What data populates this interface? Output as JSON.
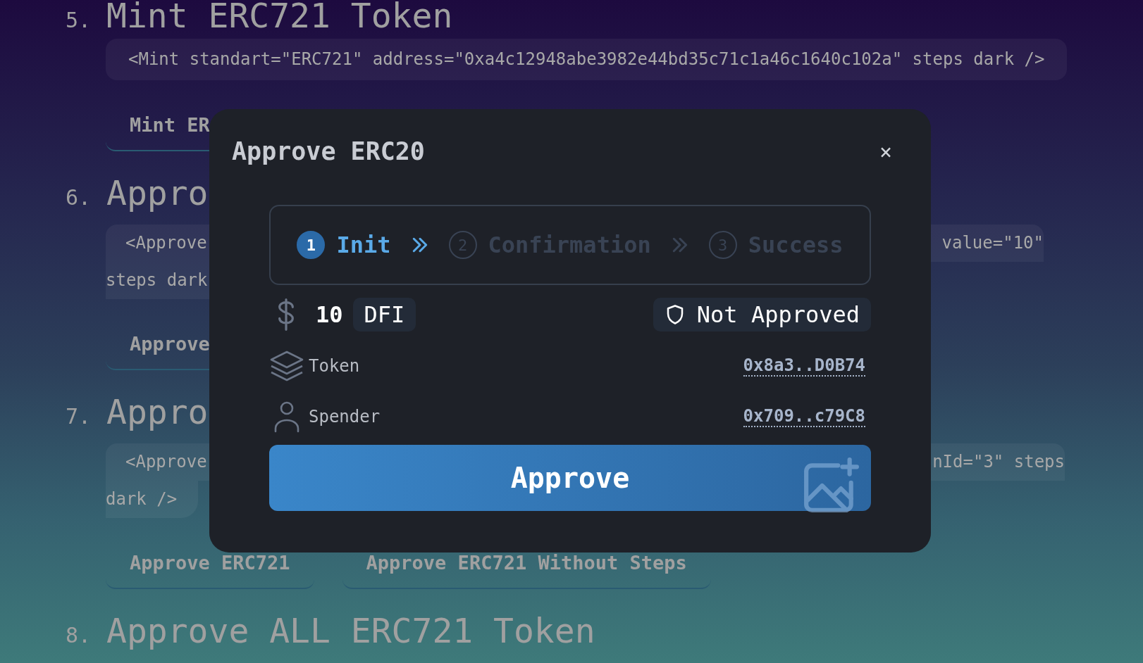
{
  "sections": [
    {
      "number": "5.",
      "title": "Mint ERC721 Token",
      "code_lines": [
        {
          "text": "<Mint standart=\"ERC721\" address=\"0xa4c12948abe3982e44bd35c71c1a46c1640c102a\" steps dark />"
        }
      ],
      "buttons": [
        "Mint ER"
      ]
    },
    {
      "number": "6.",
      "title": "Appro",
      "code_lines": [
        {
          "text": "<Approve",
          "text_right": "value=\"10\""
        },
        {
          "text": "steps dark"
        }
      ],
      "buttons": [
        "Approve"
      ]
    },
    {
      "number": "7.",
      "title": "Appro",
      "code_lines": [
        {
          "text": "<Approve",
          "text_right": "nId=\"3\" steps"
        },
        {
          "text": "dark />"
        }
      ],
      "buttons": [
        "Approve ERC721",
        "Approve ERC721 Without Steps"
      ]
    },
    {
      "number": "8.",
      "title": "Approve ALL ERC721 Token"
    }
  ],
  "modal": {
    "title": "Approve ERC20",
    "close": "×",
    "steps": [
      {
        "number": "1",
        "label": "Init",
        "active": true
      },
      {
        "number": "2",
        "label": "Confirmation",
        "active": false
      },
      {
        "number": "3",
        "label": "Success",
        "active": false
      }
    ],
    "amount": "10",
    "currency": "DFI",
    "status": "Not Approved",
    "details": [
      {
        "kind": "token",
        "label": "Token",
        "value": "0x8a3..D0B74"
      },
      {
        "kind": "spender",
        "label": "Spender",
        "value": "0x709..c79C8"
      }
    ],
    "action": "Approve"
  }
}
